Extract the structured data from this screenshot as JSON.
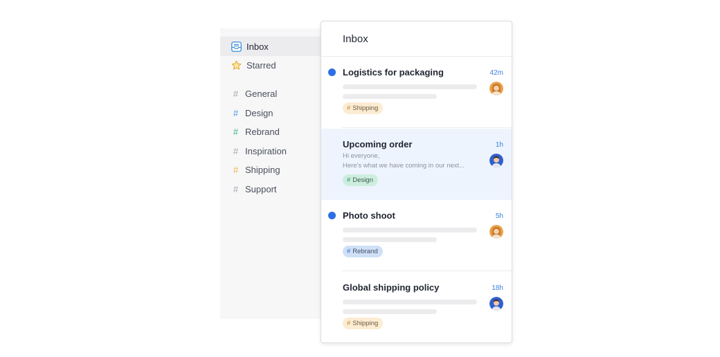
{
  "sidebar": {
    "items": [
      {
        "label": "Inbox",
        "icon": "inbox-icon",
        "active": true
      },
      {
        "label": "Starred",
        "icon": "star-icon"
      },
      {
        "label": "General",
        "icon": "hash-icon"
      },
      {
        "label": "Design",
        "icon": "hash-icon"
      },
      {
        "label": "Rebrand",
        "icon": "hash-icon"
      },
      {
        "label": "Inspiration",
        "icon": "hash-icon"
      },
      {
        "label": "Shipping",
        "icon": "hash-icon"
      },
      {
        "label": "Support",
        "icon": "hash-icon"
      }
    ],
    "hash_symbol": "#"
  },
  "panel": {
    "title": "Inbox",
    "messages": [
      {
        "title": "Logistics for packaging",
        "time": "42m",
        "unread": true,
        "tag": "Shipping",
        "avatar": "woman-avatar"
      },
      {
        "title": "Upcoming order",
        "time": "1h",
        "unread": false,
        "preview_line1": "Hi everyone,",
        "preview_line2": "Here's what we have coming in our next...",
        "tag": "Design",
        "avatar": "man-avatar"
      },
      {
        "title": "Photo shoot",
        "time": "5h",
        "unread": true,
        "tag": "Rebrand",
        "avatar": "woman-avatar"
      },
      {
        "title": "Global shipping policy",
        "time": "18h",
        "unread": false,
        "tag": "Shipping",
        "avatar": "man-avatar"
      }
    ]
  },
  "colors": {
    "accent": "#2c6ee6",
    "selected_row": "#edf4fd",
    "tag_shipping": "#fcecd2",
    "tag_design": "#cdeede",
    "tag_rebrand": "#cfe0f7"
  }
}
